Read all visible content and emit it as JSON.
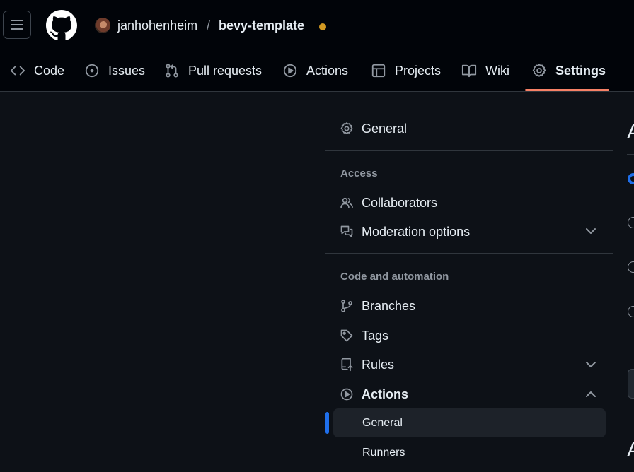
{
  "header": {
    "owner": "janhohenheim",
    "separator": "/",
    "repo": "bevy-template"
  },
  "tabs": [
    {
      "label": "Code",
      "icon": "code-icon"
    },
    {
      "label": "Issues",
      "icon": "issue-icon"
    },
    {
      "label": "Pull requests",
      "icon": "pull-request-icon"
    },
    {
      "label": "Actions",
      "icon": "play-icon"
    },
    {
      "label": "Projects",
      "icon": "table-icon"
    },
    {
      "label": "Wiki",
      "icon": "book-icon"
    },
    {
      "label": "Settings",
      "icon": "gear-icon",
      "selected": true
    }
  ],
  "sidebar": {
    "general": "General",
    "access_heading": "Access",
    "collaborators": "Collaborators",
    "moderation": "Moderation options",
    "code_heading": "Code and automation",
    "branches": "Branches",
    "tags": "Tags",
    "rules": "Rules",
    "actions": "Actions",
    "actions_sub": [
      {
        "label": "General",
        "selected": true
      },
      {
        "label": "Runners"
      }
    ]
  },
  "colors": {
    "background": "#0d1117",
    "header": "#010409",
    "accent": "#1f6feb",
    "tab_underline": "#f78166",
    "status_dot": "#d29922"
  }
}
